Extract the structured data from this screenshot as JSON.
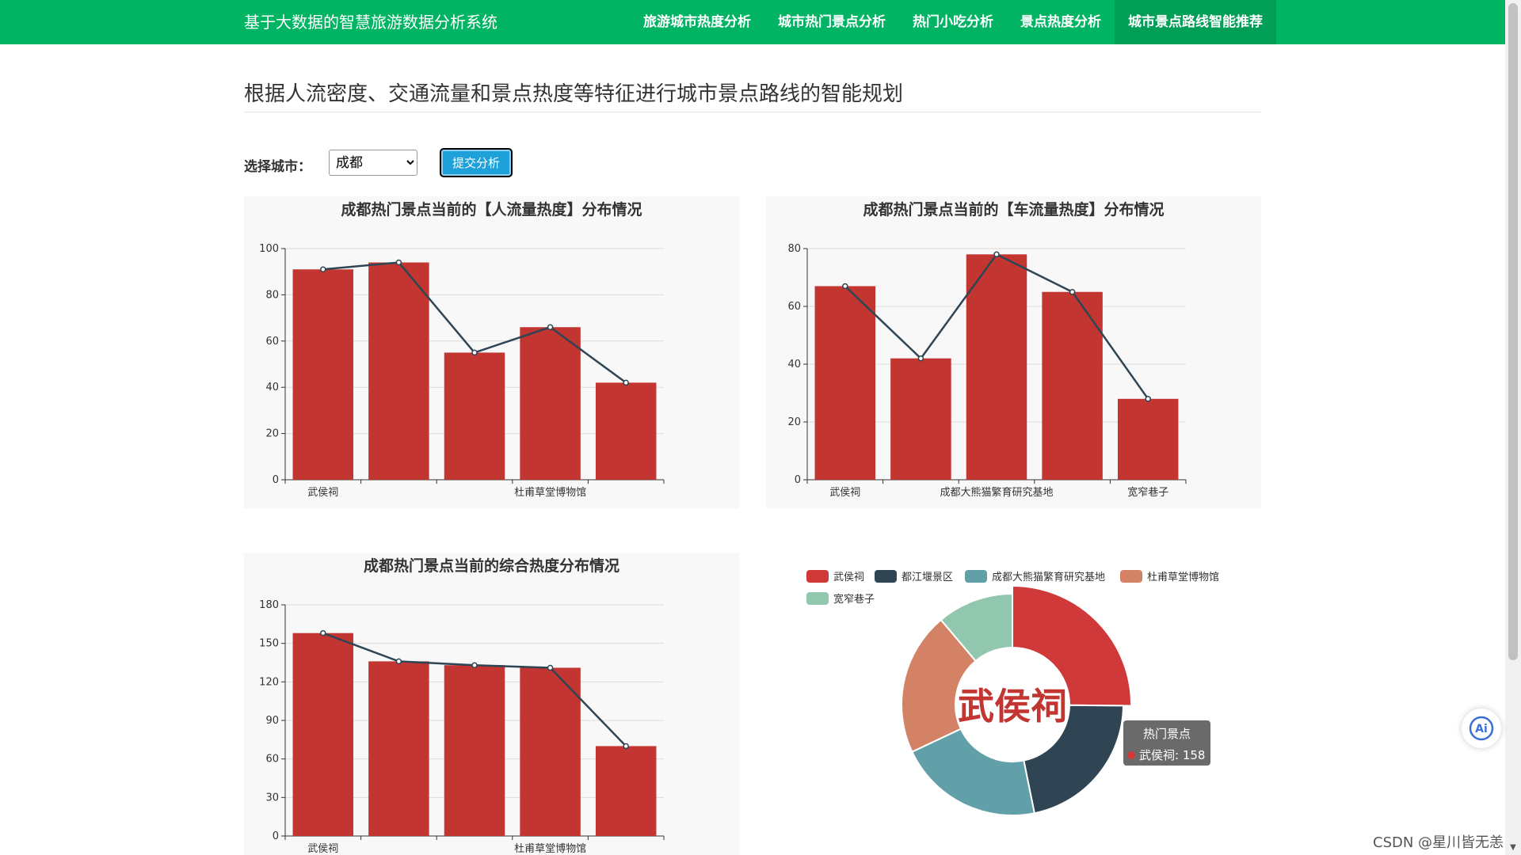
{
  "app": {
    "title": "基于大数据的智慧旅游数据分析系统",
    "nav": [
      {
        "label": "旅游城市热度分析",
        "active": false
      },
      {
        "label": "城市热门景点分析",
        "active": false
      },
      {
        "label": "热门小吃分析",
        "active": false
      },
      {
        "label": "景点热度分析",
        "active": false
      },
      {
        "label": "城市景点路线智能推荐",
        "active": true
      }
    ]
  },
  "page": {
    "title": "根据人流密度、交通流量和景点热度等特征进行城市景点路线的智能规划",
    "city_label": "选择城市：",
    "city_selected": "成都",
    "submit_label": "提交分析",
    "watermark": "CSDN @星川皆无恙"
  },
  "colors": {
    "nav_bg": "#00b463",
    "bar": "#c23531",
    "line": "#2f4554"
  },
  "chart_data": [
    {
      "type": "bar",
      "title": "成都热门景点当前的【人流量热度】分布情况",
      "categories": [
        "武侯祠",
        "都江堰景区",
        "成都大熊猫繁育研究基地",
        "杜甫草堂博物馆",
        "宽窄巷子"
      ],
      "visible_tick_labels": [
        "武侯祠",
        "杜甫草堂博物馆"
      ],
      "values": [
        91,
        94,
        55,
        66,
        42
      ],
      "line_overlay": true,
      "ylim": [
        0,
        100
      ],
      "yticks": [
        0,
        20,
        40,
        60,
        80,
        100
      ],
      "grid": true
    },
    {
      "type": "bar",
      "title": "成都热门景点当前的【车流量热度】分布情况",
      "categories": [
        "武侯祠",
        "都江堰景区",
        "成都大熊猫繁育研究基地",
        "杜甫草堂博物馆",
        "宽窄巷子"
      ],
      "visible_tick_labels": [
        "武侯祠",
        "成都大熊猫繁育研究基地",
        "宽窄巷子"
      ],
      "values": [
        67,
        42,
        78,
        65,
        28
      ],
      "line_overlay": true,
      "ylim": [
        0,
        80
      ],
      "yticks": [
        0,
        20,
        40,
        60,
        80
      ],
      "grid": true
    },
    {
      "type": "bar",
      "title": "成都热门景点当前的综合热度分布情况",
      "categories": [
        "武侯祠",
        "都江堰景区",
        "成都大熊猫繁育研究基地",
        "杜甫草堂博物馆",
        "宽窄巷子"
      ],
      "visible_tick_labels": [
        "武侯祠",
        "杜甫草堂博物馆"
      ],
      "values": [
        158,
        136,
        133,
        131,
        70
      ],
      "line_overlay": true,
      "ylim": [
        0,
        180
      ],
      "yticks": [
        0,
        30,
        60,
        90,
        120,
        150,
        180
      ],
      "grid": true
    },
    {
      "type": "pie",
      "donut": true,
      "legend_position": "top",
      "center_label": "武侯祠",
      "categories": [
        "武侯祠",
        "都江堰景区",
        "成都大熊猫繁育研究基地",
        "杜甫草堂博物馆",
        "宽窄巷子"
      ],
      "values": [
        158,
        136,
        133,
        131,
        70
      ],
      "colors": [
        "#d0393a",
        "#2f4554",
        "#61a0a8",
        "#d48265",
        "#91c7ae"
      ],
      "tooltip": {
        "title": "热门景点",
        "line": "武侯祠: 158"
      }
    }
  ]
}
